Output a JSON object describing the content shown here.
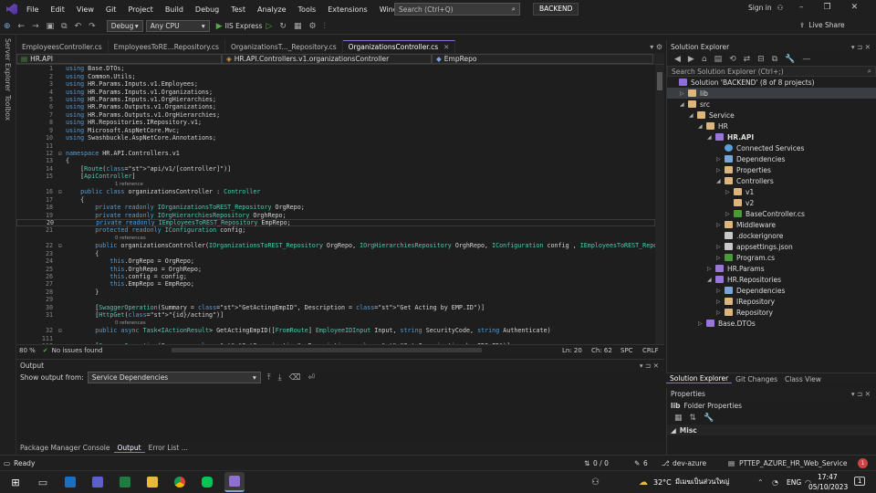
{
  "menu": {
    "items": [
      "File",
      "Edit",
      "View",
      "Git",
      "Project",
      "Build",
      "Debug",
      "Test",
      "Analyze",
      "Tools",
      "Extensions",
      "Window",
      "Help"
    ]
  },
  "search": {
    "placeholder": "Search (Ctrl+Q)"
  },
  "solution_badge": "BACKEND",
  "account": {
    "sign_in": "Sign in"
  },
  "live_share": "Live Share",
  "toolbar": {
    "config": "Debug",
    "platform": "Any CPU",
    "run_label": "IIS Express"
  },
  "left_rail": [
    "Server Explorer",
    "Toolbox"
  ],
  "doc_tabs": [
    {
      "label": "EmployeesController.cs",
      "active": false
    },
    {
      "label": "EmployeesToRE...Repository.cs",
      "active": false
    },
    {
      "label": "OrganizationsT..._Repository.cs",
      "active": false
    },
    {
      "label": "OrganizationsController.cs",
      "active": true
    }
  ],
  "navbar": {
    "project": "HR.API",
    "class": "HR.API.Controllers.v1.organizationsController",
    "member": "EmpRepo"
  },
  "code": {
    "ref1": "1 reference",
    "ref0": "0 references",
    "lines": [
      {
        "n": "1",
        "t": "using Base.DTOs;"
      },
      {
        "n": "2",
        "t": "using Common.Utils;"
      },
      {
        "n": "3",
        "t": "using HR.Params.Inputs.v1.Employees;"
      },
      {
        "n": "4",
        "t": "using HR.Params.Inputs.v1.Organizations;"
      },
      {
        "n": "5",
        "t": "using HR.Params.Inputs.v1.OrgHierarchies;"
      },
      {
        "n": "6",
        "t": "using HR.Params.Outputs.v1.Organizations;"
      },
      {
        "n": "7",
        "t": "using HR.Params.Outputs.v1.OrgHierarchies;"
      },
      {
        "n": "8",
        "t": "using HR.Repositories.IRepository.v1;"
      },
      {
        "n": "9",
        "t": "using Microsoft.AspNetCore.Mvc;"
      },
      {
        "n": "10",
        "t": "using Swashbuckle.AspNetCore.Annotations;"
      },
      {
        "n": "11",
        "t": ""
      },
      {
        "n": "12",
        "t": "namespace HR.API.Controllers.v1"
      },
      {
        "n": "13",
        "t": "{"
      },
      {
        "n": "14",
        "t": "    [Route(\"api/v1/[controller]\")]"
      },
      {
        "n": "15",
        "t": "    [ApiController]"
      },
      {
        "n": "16",
        "t": "    public class organizationsController : Controller"
      },
      {
        "n": "17",
        "t": "    {"
      },
      {
        "n": "18",
        "t": "        private readonly IOrganizationsToREST_Repository OrgRepo;"
      },
      {
        "n": "19",
        "t": "        private readonly IOrgHierarchiesRepository OrghRepo;"
      },
      {
        "n": "20",
        "t": "        private readonly IEmployeesToREST_Repository EmpRepo;"
      },
      {
        "n": "21",
        "t": "        protected readonly IConfiguration config;"
      },
      {
        "n": "22",
        "t": "        public organizationsController(IOrganizationsToREST_Repository OrgRepo, IOrgHierarchiesRepository OrghRepo, IConfiguration config , IEmployeesToREST_Repository"
      },
      {
        "n": "23",
        "t": "        {"
      },
      {
        "n": "24",
        "t": "            this.OrgRepo = OrgRepo;"
      },
      {
        "n": "25",
        "t": "            this.OrghRepo = OrghRepo;"
      },
      {
        "n": "26",
        "t": "            this.config = config;"
      },
      {
        "n": "27",
        "t": "            this.EmpRepo = EmpRepo;"
      },
      {
        "n": "28",
        "t": "        }"
      },
      {
        "n": "29",
        "t": ""
      },
      {
        "n": "30",
        "t": "        [SwaggerOperation(Summary = \"GetActingEmpID\", Description = \"Get Acting by EMP.ID\")]"
      },
      {
        "n": "31",
        "t": "        [HttpGet(\"{id}/acting\")]"
      },
      {
        "n": "32",
        "t": "        public async Task<IActionResult> GetActingEmpID([FromRoute] EmployeeIDInput Input, string SecurityCode, string Authenticate)"
      },
      {
        "n": "111",
        "t": ""
      },
      {
        "n": "112",
        "t": "        [SwaggerOperation(Summary = \"GetOrganization\", Description = \"Get Organization by ORG.ID\")]"
      }
    ]
  },
  "editor_status": {
    "zoom": "80 %",
    "issues": "No issues found",
    "ln": "Ln: 20",
    "ch": "Ch: 62",
    "spc": "SPC",
    "crlf": "CRLF"
  },
  "output": {
    "title": "Output",
    "show_from_label": "Show output from:",
    "source": "Service Dependencies"
  },
  "bottom_tabs": [
    {
      "label": "Package Manager Console",
      "active": false
    },
    {
      "label": "Output",
      "active": true
    },
    {
      "label": "Error List ...",
      "active": false
    }
  ],
  "solution_explorer": {
    "title": "Solution Explorer",
    "search_placeholder": "Search Solution Explorer (Ctrl+;)",
    "tree": [
      {
        "label": "Solution 'BACKEND' (8 of 8 projects)",
        "indent": 0,
        "arrow": "",
        "icon": "sol",
        "bold": false
      },
      {
        "label": "lib",
        "indent": 1,
        "arrow": "▷",
        "icon": "folder",
        "bold": false
      },
      {
        "label": "src",
        "indent": 1,
        "arrow": "◢",
        "icon": "folder",
        "bold": false
      },
      {
        "label": "Service",
        "indent": 2,
        "arrow": "◢",
        "icon": "folder",
        "bold": false
      },
      {
        "label": "HR",
        "indent": 3,
        "arrow": "◢",
        "icon": "folder",
        "bold": false
      },
      {
        "label": "HR.API",
        "indent": 4,
        "arrow": "◢",
        "icon": "proj",
        "bold": true
      },
      {
        "label": "Connected Services",
        "indent": 5,
        "arrow": "",
        "icon": "conn",
        "bold": false
      },
      {
        "label": "Dependencies",
        "indent": 5,
        "arrow": "▷",
        "icon": "dep",
        "bold": false
      },
      {
        "label": "Properties",
        "indent": 5,
        "arrow": "▷",
        "icon": "folder",
        "bold": false
      },
      {
        "label": "Controllers",
        "indent": 5,
        "arrow": "◢",
        "icon": "folder",
        "bold": false
      },
      {
        "label": "v1",
        "indent": 6,
        "arrow": "▷",
        "icon": "folder",
        "bold": false
      },
      {
        "label": "v2",
        "indent": 6,
        "arrow": "",
        "icon": "folder",
        "bold": false
      },
      {
        "label": "BaseController.cs",
        "indent": 6,
        "arrow": "▷",
        "icon": "cs",
        "bold": false
      },
      {
        "label": "Middleware",
        "indent": 5,
        "arrow": "▷",
        "icon": "folder",
        "bold": false
      },
      {
        "label": ".dockerignore",
        "indent": 5,
        "arrow": "",
        "icon": "file",
        "bold": false
      },
      {
        "label": "appsettings.json",
        "indent": 5,
        "arrow": "▷",
        "icon": "file",
        "bold": false
      },
      {
        "label": "Program.cs",
        "indent": 5,
        "arrow": "▷",
        "icon": "cs",
        "bold": false
      },
      {
        "label": "HR.Params",
        "indent": 4,
        "arrow": "▷",
        "icon": "proj",
        "bold": false
      },
      {
        "label": "HR.Repositories",
        "indent": 4,
        "arrow": "◢",
        "icon": "proj",
        "bold": false
      },
      {
        "label": "Dependencies",
        "indent": 5,
        "arrow": "▷",
        "icon": "dep",
        "bold": false
      },
      {
        "label": "IRepository",
        "indent": 5,
        "arrow": "▷",
        "icon": "folder",
        "bold": false
      },
      {
        "label": "Repository",
        "indent": 5,
        "arrow": "▷",
        "icon": "folder",
        "bold": false
      },
      {
        "label": "Base.DTOs",
        "indent": 3,
        "arrow": "▷",
        "icon": "proj",
        "bold": false
      }
    ]
  },
  "se_tabs": [
    {
      "label": "Solution Explorer",
      "active": true
    },
    {
      "label": "Git Changes",
      "active": false
    },
    {
      "label": "Class View",
      "active": false
    }
  ],
  "properties": {
    "title": "Properties",
    "object": "lib",
    "object_type": "Folder Properties",
    "section": "Misc"
  },
  "status": {
    "ready": "Ready",
    "changes": "0 / 0",
    "commits": "6",
    "branch": "dev-azure",
    "repo": "PTTEP_AZURE_HR_Web_Service",
    "notifications": "1"
  },
  "taskbar": {
    "weather": "32°C",
    "weather_desc": "มีเมฆเป็นส่วนใหญ่",
    "lang": "ENG",
    "time": "17:47",
    "date": "05/10/2023",
    "notif_count": "1"
  }
}
